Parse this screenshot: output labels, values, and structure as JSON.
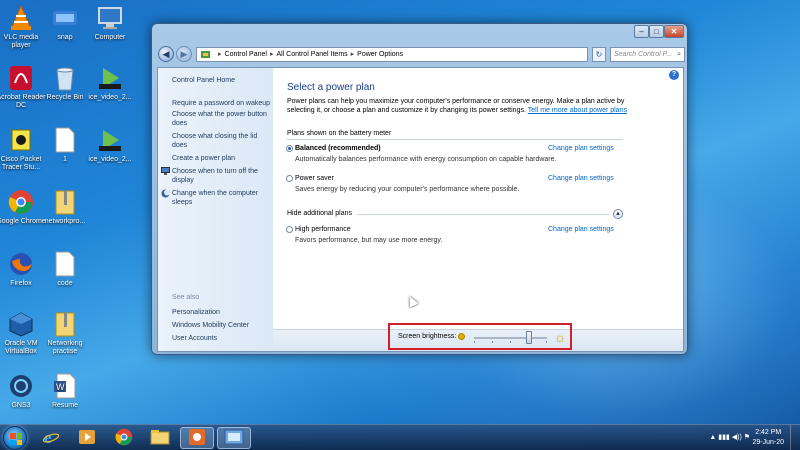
{
  "desktop": {
    "icons": [
      {
        "label": "VLC media player",
        "icon": "vlc-icon"
      },
      {
        "label": "snap",
        "icon": "snap-icon"
      },
      {
        "label": "Computer",
        "icon": "computer-icon"
      },
      {
        "label": "Acrobat Reader DC",
        "icon": "acrobat-icon"
      },
      {
        "label": "Recycle Bin",
        "icon": "recycle-bin-icon"
      },
      {
        "label": "ice_video_2...",
        "icon": "video-file-icon"
      },
      {
        "label": "Cisco Packet Tracer Stu...",
        "icon": "cisco-packet-tracer-icon"
      },
      {
        "label": "1",
        "icon": "document-icon"
      },
      {
        "label": "ice_video_2...",
        "icon": "video-file-icon"
      },
      {
        "label": "Google Chrome",
        "icon": "chrome-icon"
      },
      {
        "label": "networkpro...",
        "icon": "zip-folder-icon"
      },
      {
        "label": "Firefox",
        "icon": "firefox-icon"
      },
      {
        "label": "code",
        "icon": "document-icon"
      },
      {
        "label": "Oracle VM VirtualBox",
        "icon": "virtualbox-icon"
      },
      {
        "label": "Networking practise",
        "icon": "zip-folder-icon"
      },
      {
        "label": "GNS3",
        "icon": "gns3-icon"
      },
      {
        "label": "Resume",
        "icon": "word-document-icon"
      }
    ]
  },
  "window": {
    "controls": {
      "minimize": "–",
      "maximize": "□",
      "close": "✕"
    },
    "nav": {
      "back": "◀",
      "forward": "▶"
    },
    "address": {
      "crumbs": [
        "Control Panel",
        "All Control Panel Items",
        "Power Options"
      ],
      "separator": "▸"
    },
    "refresh": "↻",
    "search": {
      "placeholder": "Search Control P...",
      "icon": "search-icon"
    },
    "help": "?",
    "sidebar": {
      "home": "Control Panel Home",
      "items": [
        "Require a password on wakeup",
        "Choose what the power button does",
        "Choose what closing the lid does",
        "Create a power plan",
        "Choose when to turn off the display",
        "Change when the computer sleeps"
      ],
      "see_also_title": "See also",
      "see_also": [
        "Personalization",
        "Windows Mobility Center",
        "User Accounts"
      ]
    },
    "main": {
      "title": "Select a power plan",
      "intro": "Power plans can help you maximize your computer's performance or conserve energy. Make a plan active by selecting it, or choose a plan and customize it by changing its power settings.",
      "intro_link": "Tell me more about power plans",
      "battery_section": "Plans shown on the battery meter",
      "plans": [
        {
          "name": "Balanced (recommended)",
          "desc": "Automatically balances performance with energy consumption on capable hardware.",
          "selected": true,
          "link": "Change plan settings"
        },
        {
          "name": "Power saver",
          "desc": "Saves energy by reducing your computer's performance where possible.",
          "selected": false,
          "link": "Change plan settings"
        }
      ],
      "hidden_section": "Hide additional plans",
      "hidden_plans": [
        {
          "name": "High performance",
          "desc": "Favors performance, but may use more energy.",
          "selected": false,
          "link": "Change plan settings"
        }
      ]
    },
    "brightness": {
      "label": "Screen brightness:",
      "level_percent": 75
    }
  },
  "taskbar": {
    "apps": [
      "ie-icon",
      "media-player-icon",
      "chrome-icon",
      "explorer-icon",
      "media-app-icon",
      "control-panel-icon"
    ],
    "tray": "▲ ▮▮▮ ◀)) ⚑",
    "time": "2:42 PM",
    "date": "29-Jun-20"
  },
  "colors": {
    "accent": "#1a3e8c",
    "link": "#0066cc",
    "highlight_box": "#d0202a"
  }
}
